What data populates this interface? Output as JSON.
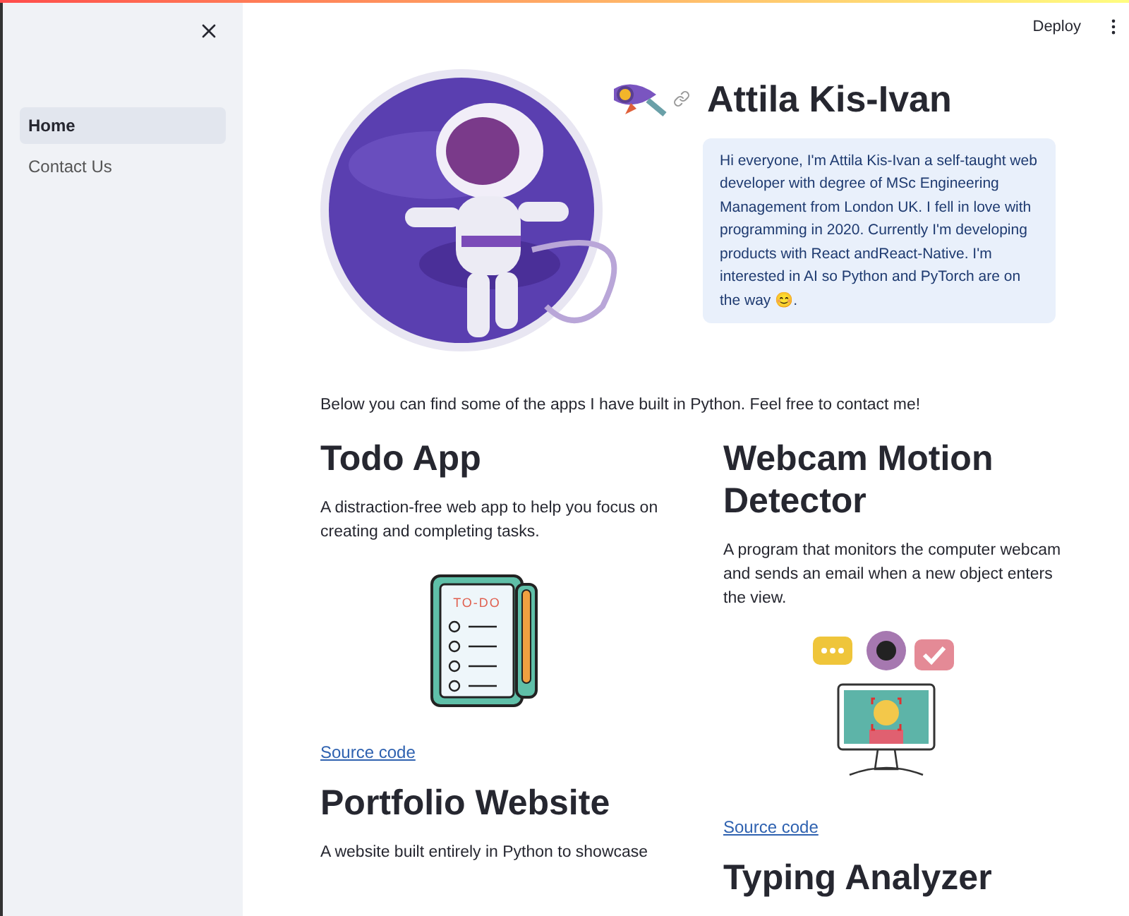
{
  "sidebar": {
    "items": [
      {
        "label": "Home",
        "selected": true
      },
      {
        "label": "Contact Us",
        "selected": false
      }
    ]
  },
  "header": {
    "deploy": "Deploy"
  },
  "hero": {
    "title": "Attila Kis-Ivan",
    "bio": "Hi everyone, I'm Attila Kis-Ivan a self-taught web developer with degree of MSc Engineering Management from London UK. I fell in love with programming in 2020. Currently I'm developing products with React andReact-Native. I'm interested in AI so Python and PyTorch are on the way 😊."
  },
  "intro": "Below you can find some of the apps I have built in Python. Feel free to contact me!",
  "columns": [
    {
      "apps": [
        {
          "title": "Todo App",
          "description": "A distraction-free web app to help you focus on creating and completing tasks.",
          "kind": "todo",
          "art_label": "TO-DO",
          "link": "Source code"
        },
        {
          "title": "Portfolio Website",
          "description": "A website built entirely in Python to showcase",
          "kind": "none"
        }
      ]
    },
    {
      "apps": [
        {
          "title": "Webcam Motion Detector",
          "description": "A program that monitors the computer webcam and sends an email when a new object enters the view.",
          "kind": "webcam",
          "link": "Source code"
        },
        {
          "title": "Typing Analyzer",
          "kind": "none"
        }
      ]
    }
  ]
}
